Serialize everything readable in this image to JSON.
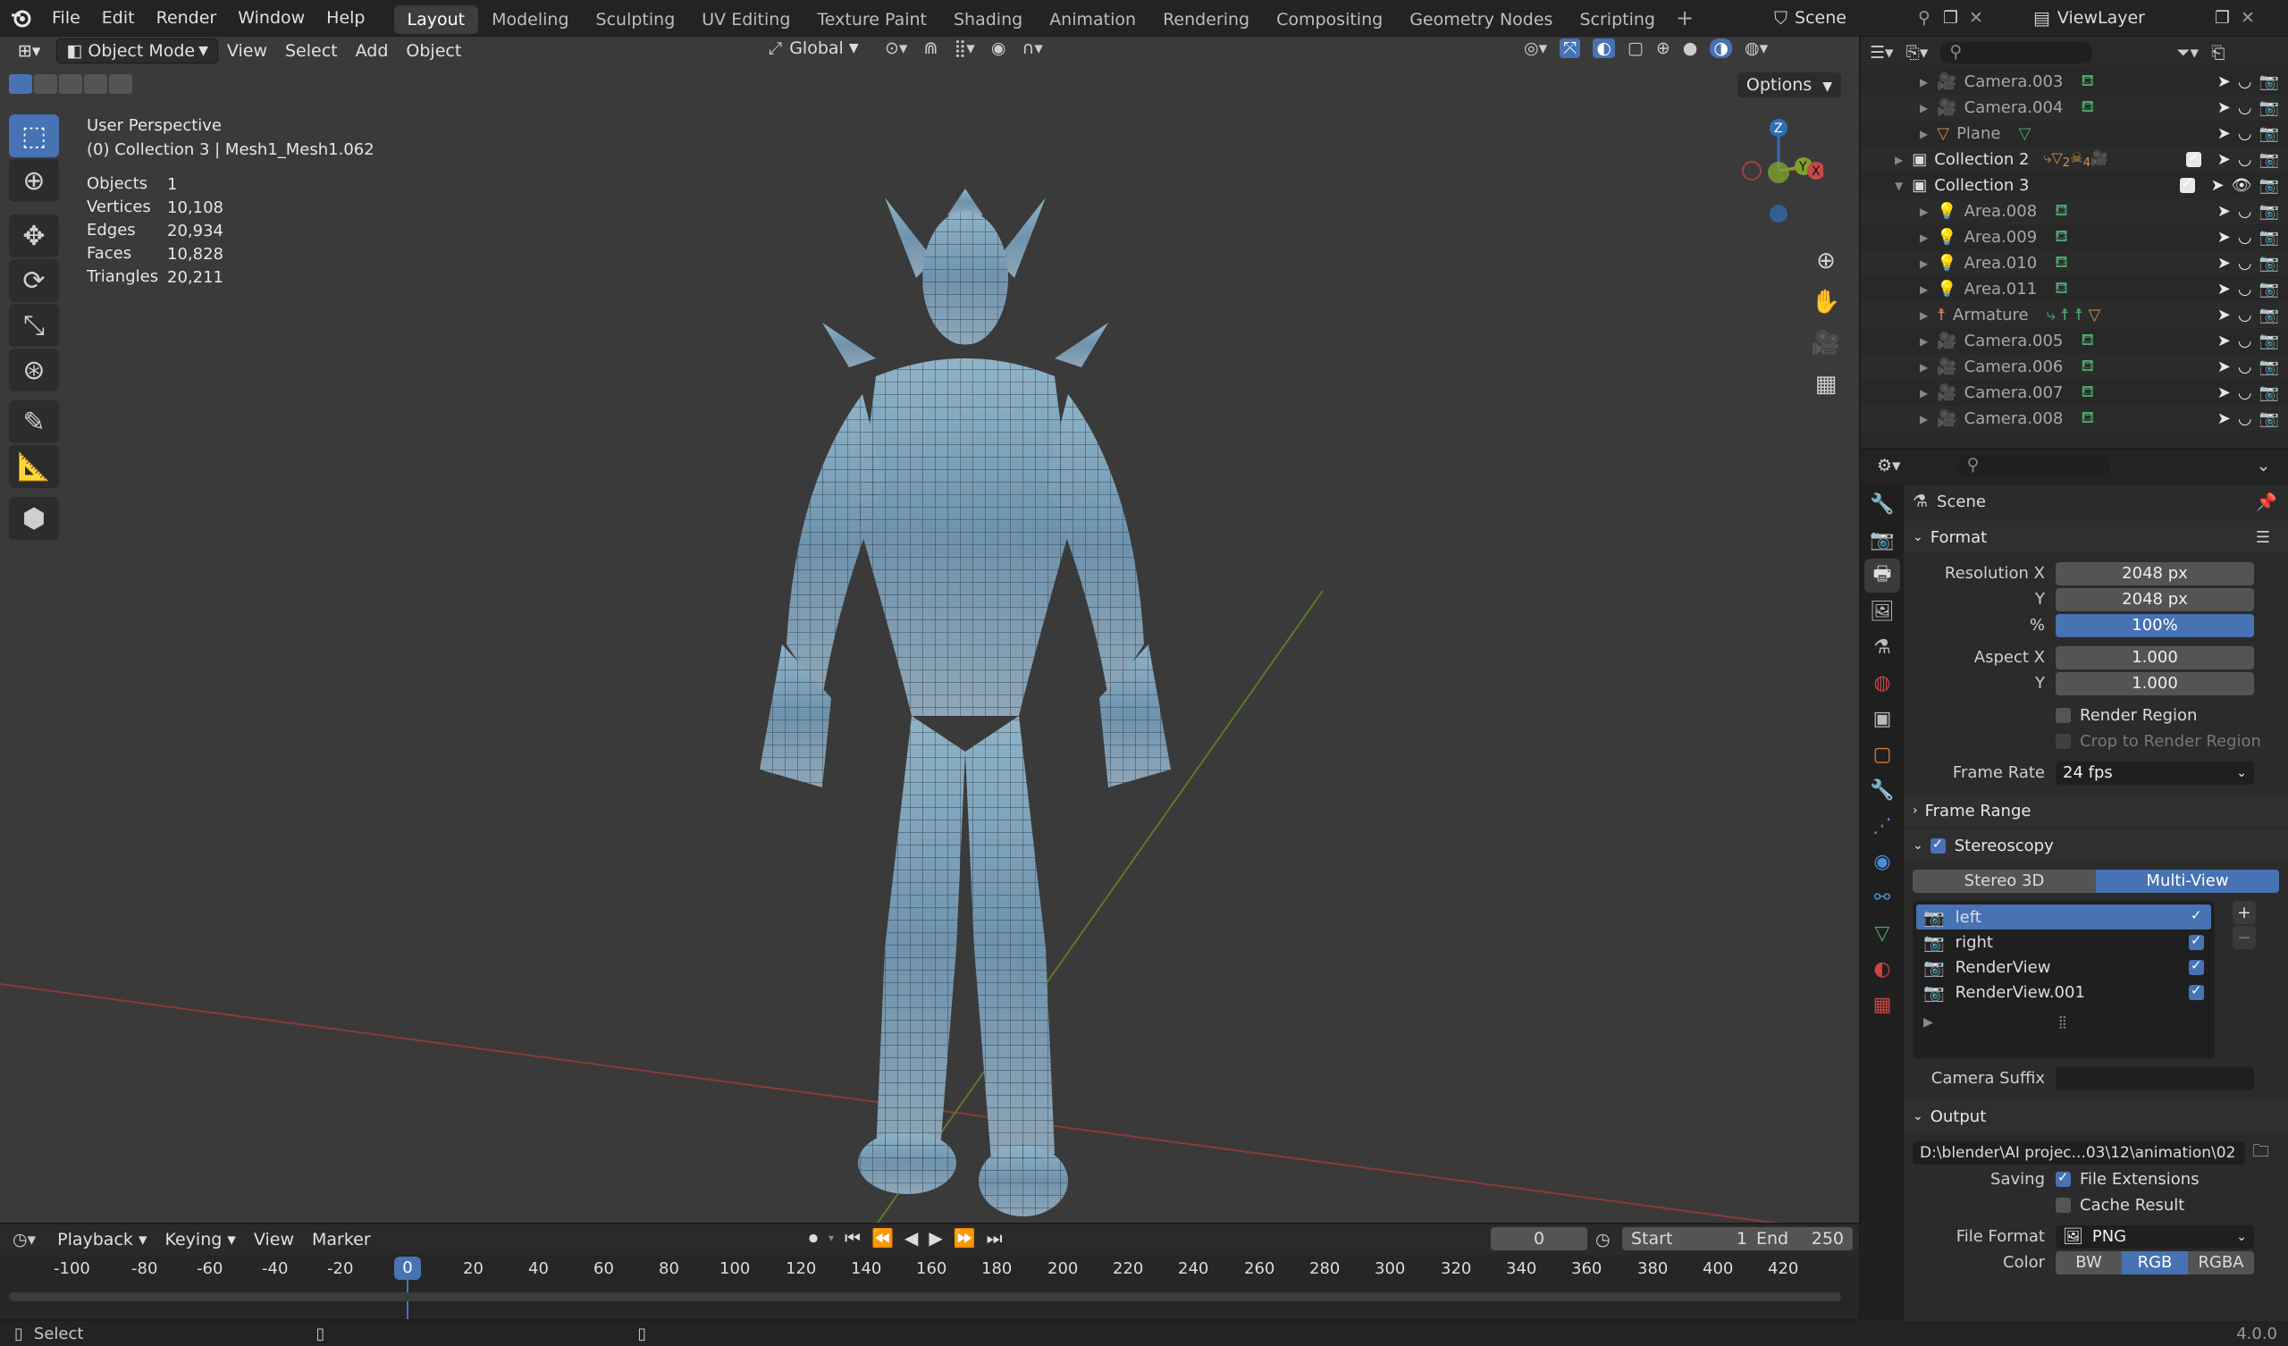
{
  "app": {
    "menu": [
      "File",
      "Edit",
      "Render",
      "Window",
      "Help"
    ],
    "workspaces": [
      "Layout",
      "Modeling",
      "Sculpting",
      "UV Editing",
      "Texture Paint",
      "Shading",
      "Animation",
      "Rendering",
      "Compositing",
      "Geometry Nodes",
      "Scripting"
    ],
    "active_workspace": "Layout",
    "scene": "Scene",
    "view_layer": "ViewLayer",
    "version": "4.0.0"
  },
  "viewport": {
    "mode": "Object Mode",
    "menus": [
      "View",
      "Select",
      "Add",
      "Object"
    ],
    "transform_orientation": "Global",
    "options": "Options",
    "perspective": "User Perspective",
    "context": "(0) Collection 3 | Mesh1_Mesh1.062",
    "stats": [
      {
        "label": "Objects",
        "value": "1"
      },
      {
        "label": "Vertices",
        "value": "10,108"
      },
      {
        "label": "Edges",
        "value": "20,934"
      },
      {
        "label": "Faces",
        "value": "10,828"
      },
      {
        "label": "Triangles",
        "value": "20,211"
      }
    ],
    "gizmo": {
      "z": "Z",
      "y": "Y",
      "x": "X"
    }
  },
  "outliner": {
    "rows": [
      {
        "name": "Camera.003",
        "type": "camera"
      },
      {
        "name": "Camera.004",
        "type": "camera"
      },
      {
        "name": "Plane",
        "type": "mesh"
      },
      {
        "name": "Collection 2",
        "type": "collection"
      },
      {
        "name": "Collection 3",
        "type": "collection"
      },
      {
        "name": "Area.008",
        "type": "light"
      },
      {
        "name": "Area.009",
        "type": "light"
      },
      {
        "name": "Area.010",
        "type": "light"
      },
      {
        "name": "Area.011",
        "type": "light"
      },
      {
        "name": "Armature",
        "type": "armature"
      },
      {
        "name": "Camera.005",
        "type": "camera"
      },
      {
        "name": "Camera.006",
        "type": "camera"
      },
      {
        "name": "Camera.007",
        "type": "camera"
      },
      {
        "name": "Camera.008",
        "type": "camera"
      }
    ],
    "collection2_badges": [
      "2",
      "4"
    ]
  },
  "properties": {
    "context": "Scene",
    "format": {
      "title": "Format",
      "resolution_x_label": "Resolution X",
      "resolution_x": "2048 px",
      "y_label": "Y",
      "resolution_y": "2048 px",
      "pct_label": "%",
      "percent": "100%",
      "aspect_x_label": "Aspect X",
      "aspect_x": "1.000",
      "aspect_y": "1.000",
      "render_region": "Render Region",
      "crop": "Crop to Render Region",
      "frame_rate_label": "Frame Rate",
      "frame_rate": "24 fps"
    },
    "frame_range": "Frame Range",
    "stereoscopy": {
      "title": "Stereoscopy",
      "mode_a": "Stereo 3D",
      "mode_b": "Multi-View",
      "views": [
        "left",
        "right",
        "RenderView",
        "RenderView.001"
      ],
      "camera_suffix_label": "Camera Suffix",
      "camera_suffix": ""
    },
    "output": {
      "title": "Output",
      "path": "D:\\blender\\AI projec...03\\12\\animation\\02",
      "saving_label": "Saving",
      "file_extensions": "File Extensions",
      "cache_result": "Cache Result",
      "file_format_label": "File Format",
      "file_format": "PNG",
      "color_label": "Color",
      "color_modes": [
        "BW",
        "RGB",
        "RGBA"
      ]
    }
  },
  "timeline": {
    "menus": [
      "Playback",
      "Keying",
      "View",
      "Marker"
    ],
    "current_frame": "0",
    "start_label": "Start",
    "start": "1",
    "end_label": "End",
    "end": "250",
    "ruler": [
      "-100",
      "-80",
      "-60",
      "-40",
      "-20",
      "0",
      "20",
      "40",
      "60",
      "80",
      "100",
      "120",
      "140",
      "160",
      "180",
      "200",
      "220",
      "240",
      "260",
      "280",
      "300",
      "320",
      "340",
      "360",
      "380",
      "400",
      "420"
    ]
  },
  "status": {
    "select": "Select"
  }
}
